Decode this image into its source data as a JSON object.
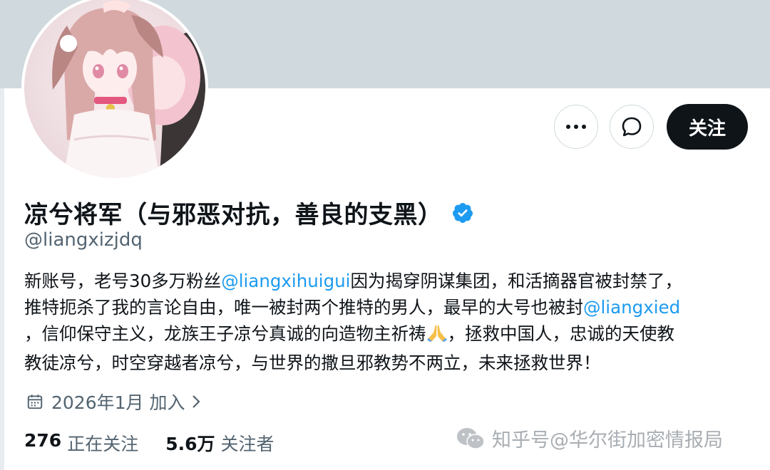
{
  "profile": {
    "display_name": "凉兮将军（与邪恶对抗，善良的支黑）",
    "handle": "@liangxizjdq",
    "verified_icon": "verified-badge-icon",
    "avatar_icon": "anime-avatar-image"
  },
  "actions": {
    "more_icon": "more-horizontal-icon",
    "message_icon": "chat-bubble-icon",
    "follow_label": "关注"
  },
  "bio": {
    "line1_a": "新账号，老号30多万粉丝",
    "line1_mention": "@liangxihuigui",
    "line1_b": "因为揭穿阴谋集团，和活摘器官被封禁了，",
    "line2_a": "推特扼杀了我的言论自由，唯一被封两个推特的男人，最早的大号也被封",
    "line2_mention": "@liangxied",
    "line3_a": "，信仰保守主义，龙族王子凉兮真诚的向造物主祈祷",
    "line3_b": "，拯救中国人，忠诚的天使教",
    "line4": "教徒凉兮，时空穿越者凉兮，与世界的撒旦邪教势不两立，未来拯救世界！"
  },
  "joined": {
    "icon": "calendar-icon",
    "text": "2026年1月 加入",
    "chevron_icon": "chevron-right-icon"
  },
  "stats": {
    "following_count": "276",
    "following_label": "正在关注",
    "followers_count": "5.6万",
    "followers_label": "关注者"
  },
  "watermark": {
    "icon": "wechat-icon",
    "text": "知乎号@华尔街加密情报局"
  },
  "colors": {
    "banner": "#cfd9de",
    "link": "#1d9bf0",
    "verified": "#1d9bf0",
    "follow_bg": "#0f1419",
    "secondary_text": "#536471"
  }
}
